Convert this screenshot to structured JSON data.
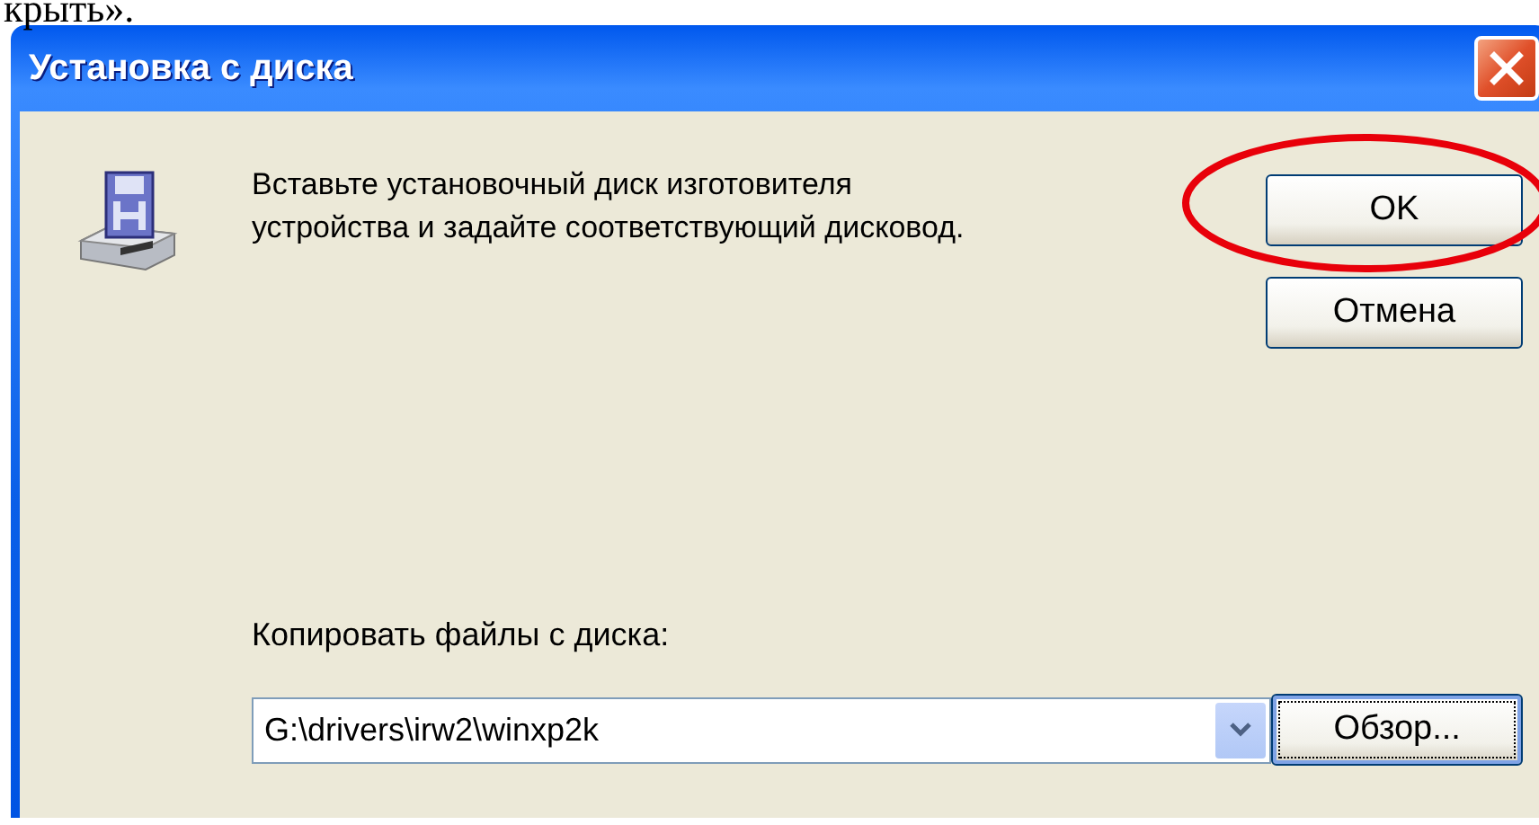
{
  "top_text": "крыть».",
  "dialog": {
    "title": "Установка с диска",
    "message": "Вставьте установочный диск изготовителя\nустройства и задайте соответствующий дисковод.",
    "buttons": [
      {
        "label": "OK",
        "circled": true,
        "focused": false
      },
      {
        "label": "Отмена",
        "circled": false,
        "focused": false
      }
    ],
    "copy_from": {
      "label": "Копировать файлы с диска:",
      "value": "G:\\drivers\\irw2\\winxp2k"
    },
    "browse_button": {
      "label": "Обзор...",
      "focused": true
    }
  }
}
